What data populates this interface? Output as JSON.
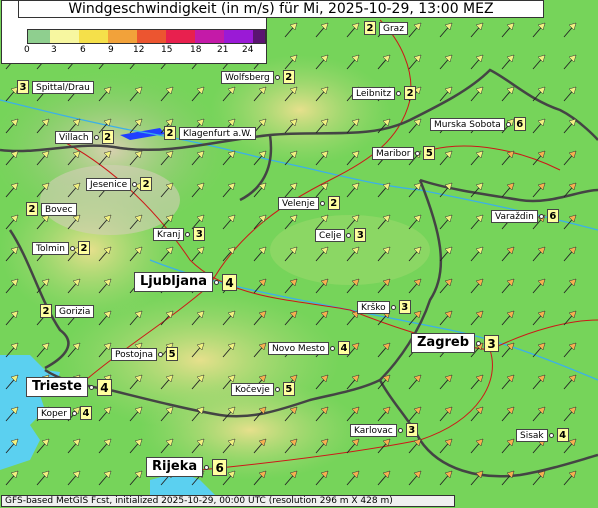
{
  "title": "Windgeschwindigkeit (in m/s) für Mi, 2025-10-29, 13:00 MEZ",
  "legend": {
    "ticks": [
      "0",
      "3",
      "6",
      "9",
      "12",
      "15",
      "18",
      "21",
      "24"
    ],
    "colors": [
      "#8fcf8f",
      "#f7f7a0",
      "#f5e04a",
      "#f2a23a",
      "#ec5530",
      "#e8204e",
      "#c41aa8",
      "#9a1ad6",
      "#5a1470"
    ]
  },
  "cities": [
    {
      "name": "Graz",
      "value": "2",
      "type": "small",
      "value_first": true
    },
    {
      "name": "Spittal/Drau",
      "value": "3",
      "type": "small",
      "value_first": true
    },
    {
      "name": "Wolfsberg",
      "value": "2",
      "type": "small"
    },
    {
      "name": "Leibnitz",
      "value": "2",
      "type": "small"
    },
    {
      "name": "Villach",
      "value": "2",
      "type": "small"
    },
    {
      "name": "Klagenfurt a.W.",
      "value": "2",
      "type": "small",
      "value_first": true
    },
    {
      "name": "Murska Sobota",
      "value": "6",
      "type": "small"
    },
    {
      "name": "Maribor",
      "value": "5",
      "type": "small"
    },
    {
      "name": "Jesenice",
      "value": "2",
      "type": "small"
    },
    {
      "name": "Bovec",
      "value": "2",
      "type": "small",
      "value_first": true
    },
    {
      "name": "Velenje",
      "value": "2",
      "type": "small"
    },
    {
      "name": "Varaždin",
      "value": "6",
      "type": "small"
    },
    {
      "name": "Kranj",
      "value": "3",
      "type": "small"
    },
    {
      "name": "Celje",
      "value": "3",
      "type": "small"
    },
    {
      "name": "Tolmin",
      "value": "2",
      "type": "small"
    },
    {
      "name": "Ljubljana",
      "value": "4",
      "type": "big"
    },
    {
      "name": "Krško",
      "value": "3",
      "type": "small"
    },
    {
      "name": "Gorizia",
      "value": "2",
      "type": "small",
      "value_first": true
    },
    {
      "name": "Zagreb",
      "value": "3",
      "type": "big"
    },
    {
      "name": "Postojna",
      "value": "5",
      "type": "small"
    },
    {
      "name": "Novo Mesto",
      "value": "4",
      "type": "small"
    },
    {
      "name": "Trieste",
      "value": "4",
      "type": "big"
    },
    {
      "name": "Kočevje",
      "value": "5",
      "type": "small"
    },
    {
      "name": "Koper",
      "value": "4",
      "type": "small"
    },
    {
      "name": "Karlovac",
      "value": "3",
      "type": "small"
    },
    {
      "name": "Sisak",
      "value": "4",
      "type": "small"
    },
    {
      "name": "Rijeka",
      "value": "6",
      "type": "big"
    }
  ],
  "footer": "GFS-based MetGIS Fcst, initialized 2025-10-29, 00:00 UTC  (resolution 296 m X 428 m)"
}
